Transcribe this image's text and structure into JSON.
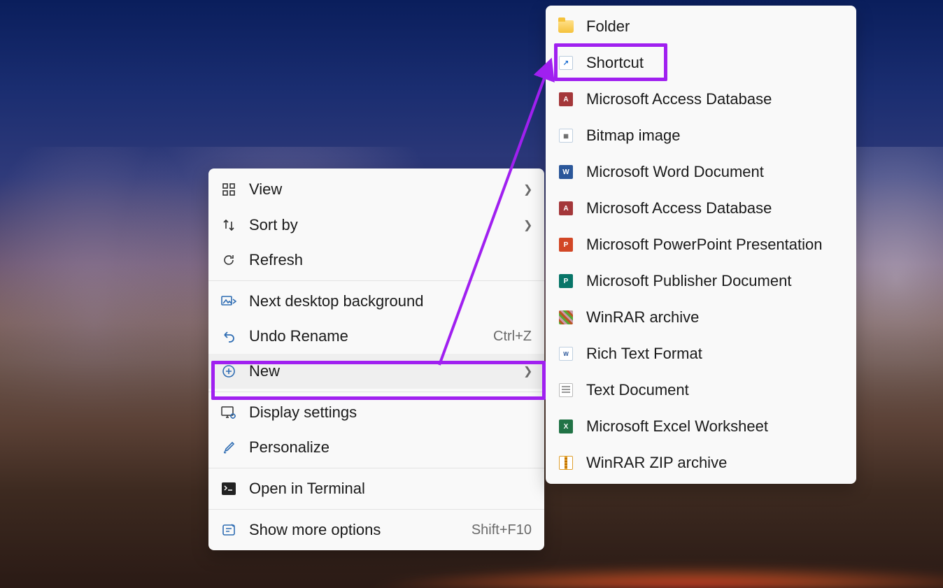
{
  "context_menu": {
    "groups": [
      [
        {
          "id": "view",
          "label": "View",
          "icon": "grid-icon",
          "has_submenu": true
        },
        {
          "id": "sortby",
          "label": "Sort by",
          "icon": "sort-icon",
          "has_submenu": true
        },
        {
          "id": "refresh",
          "label": "Refresh",
          "icon": "refresh-icon"
        }
      ],
      [
        {
          "id": "nextbg",
          "label": "Next desktop background",
          "icon": "image-next-icon"
        },
        {
          "id": "undo",
          "label": "Undo Rename",
          "icon": "undo-icon",
          "shortcut": "Ctrl+Z"
        },
        {
          "id": "new",
          "label": "New",
          "icon": "add-icon",
          "has_submenu": true,
          "hover": true,
          "highlighted": true
        }
      ],
      [
        {
          "id": "display",
          "label": "Display settings",
          "icon": "display-settings-icon"
        },
        {
          "id": "personalize",
          "label": "Personalize",
          "icon": "brush-icon"
        }
      ],
      [
        {
          "id": "terminal",
          "label": "Open in Terminal",
          "icon": "terminal-icon"
        }
      ],
      [
        {
          "id": "moreopts",
          "label": "Show more options",
          "icon": "more-options-icon",
          "shortcut": "Shift+F10"
        }
      ]
    ]
  },
  "new_submenu": {
    "items": [
      {
        "id": "folder",
        "label": "Folder",
        "icon": "folder-icon"
      },
      {
        "id": "shortcut",
        "label": "Shortcut",
        "icon": "shortcut-icon",
        "highlighted": true
      },
      {
        "id": "access1",
        "label": "Microsoft Access Database",
        "icon": "access-icon"
      },
      {
        "id": "bitmap",
        "label": "Bitmap image",
        "icon": "bitmap-icon"
      },
      {
        "id": "word",
        "label": "Microsoft Word Document",
        "icon": "word-icon"
      },
      {
        "id": "access2",
        "label": "Microsoft Access Database",
        "icon": "access-icon"
      },
      {
        "id": "ppt",
        "label": "Microsoft PowerPoint Presentation",
        "icon": "powerpoint-icon"
      },
      {
        "id": "pub",
        "label": "Microsoft Publisher Document",
        "icon": "publisher-icon"
      },
      {
        "id": "rar",
        "label": "WinRAR archive",
        "icon": "winrar-icon"
      },
      {
        "id": "rtf",
        "label": "Rich Text Format",
        "icon": "rtf-icon"
      },
      {
        "id": "txt",
        "label": "Text Document",
        "icon": "text-icon"
      },
      {
        "id": "xls",
        "label": "Microsoft Excel Worksheet",
        "icon": "excel-icon"
      },
      {
        "id": "zip",
        "label": "WinRAR ZIP archive",
        "icon": "zip-icon"
      }
    ]
  },
  "annotations": {
    "highlight_color": "#a020f0",
    "arrow_from": "new",
    "arrow_to": "shortcut"
  }
}
